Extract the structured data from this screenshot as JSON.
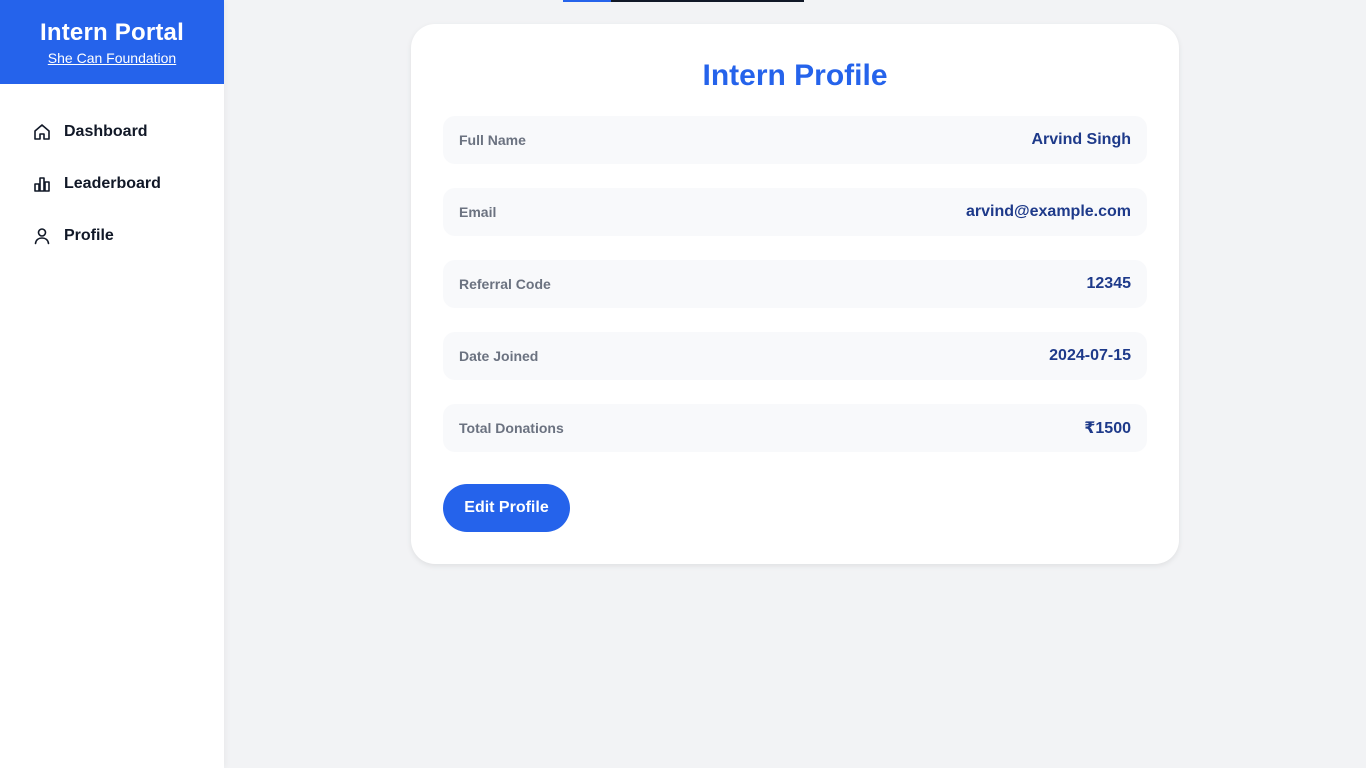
{
  "sidebar": {
    "brand_title": "Intern Portal",
    "brand_subtitle": "She Can Foundation",
    "items": [
      {
        "label": "Dashboard",
        "icon": "home-icon"
      },
      {
        "label": "Leaderboard",
        "icon": "bar-chart-icon"
      },
      {
        "label": "Profile",
        "icon": "user-icon"
      }
    ]
  },
  "profile": {
    "title": "Intern Profile",
    "fields": [
      {
        "label": "Full Name",
        "value": "Arvind Singh"
      },
      {
        "label": "Email",
        "value": "arvind@example.com"
      },
      {
        "label": "Referral Code",
        "value": "12345"
      },
      {
        "label": "Date Joined",
        "value": "2024-07-15"
      },
      {
        "label": "Total Donations",
        "value": "₹1500"
      }
    ],
    "edit_button_label": "Edit Profile"
  },
  "colors": {
    "accent": "#2563eb",
    "value_text": "#1e3a8a",
    "label_text": "#6b7280",
    "page_background": "#f2f3f5"
  }
}
